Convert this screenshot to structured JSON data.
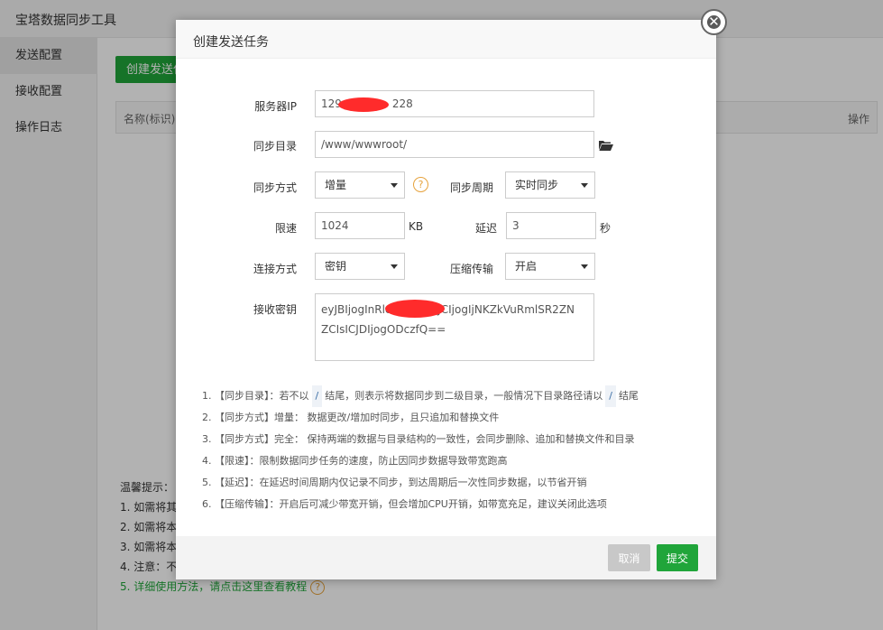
{
  "app": {
    "title": "宝塔数据同步工具",
    "sidebar": [
      {
        "label": "发送配置"
      },
      {
        "label": "接收配置"
      },
      {
        "label": "操作日志"
      }
    ],
    "create_button": "创建发送任务",
    "table": {
      "col_name": "名称(标识)",
      "col_ops": "操作"
    },
    "tips": {
      "title": "温馨提示：",
      "lines": [
        "1. 如需将其",
        "2. 如需将本",
        "3. 如需将本",
        "4. 注意：不"
      ],
      "link_prefix": "5. ",
      "link_text": "详细使用方法，请点击这里查看教程"
    }
  },
  "modal": {
    "title": "创建发送任务",
    "server_ip": {
      "label": "服务器IP",
      "value_start": "129",
      "value_end": "228"
    },
    "sync_dir": {
      "label": "同步目录",
      "value": "/www/wwwroot/"
    },
    "sync_mode": {
      "label": "同步方式",
      "value": "增量"
    },
    "sync_period": {
      "label": "同步周期",
      "value": "实时同步"
    },
    "speed_limit": {
      "label": "限速",
      "value": "1024",
      "unit": "KB"
    },
    "delay": {
      "label": "延迟",
      "value": "3",
      "unit": "秒"
    },
    "conn_mode": {
      "label": "连接方式",
      "value": "密钥"
    },
    "compress": {
      "label": "压缩传输",
      "value": "开启"
    },
    "secret_key": {
      "label": "接收密钥",
      "value_line1_start": "eyJBIjogInRlc",
      "value_line1_end": "IsICJCIjogIjNKZkVuRmlSR2ZN",
      "value_line2": "ZCIsICJDIjogODczfQ=="
    },
    "notes": {
      "n1a": "1. 【同步目录】：若不以",
      "slash": "/",
      "n1b": "结尾，则表示将数据同步到二级目录，一般情况下目录路径请以",
      "n1c": "结尾",
      "n2": "2. 【同步方式】增量： 数据更改/增加时同步，且只追加和替换文件",
      "n3": "3. 【同步方式】完全： 保持两端的数据与目录结构的一致性，会同步删除、追加和替换文件和目录",
      "n4": "4. 【限速】：限制数据同步任务的速度，防止因同步数据导致带宽跑高",
      "n5": "5. 【延迟】：在延迟时间周期内仅记录不同步，到达周期后一次性同步数据，以节省开销",
      "n6": "6. 【压缩传输】：开启后可减少带宽开销，但会增加CPU开销，如带宽充足，建议关闭此选项"
    },
    "cancel": "取消",
    "submit": "提交"
  },
  "icons": {
    "close": "close-icon",
    "help": "question-circle-icon",
    "folder": "folder-open-icon"
  },
  "colors": {
    "accent": "#20a53a",
    "help": "#e6a23c",
    "redaction": "#ff2b2b"
  }
}
